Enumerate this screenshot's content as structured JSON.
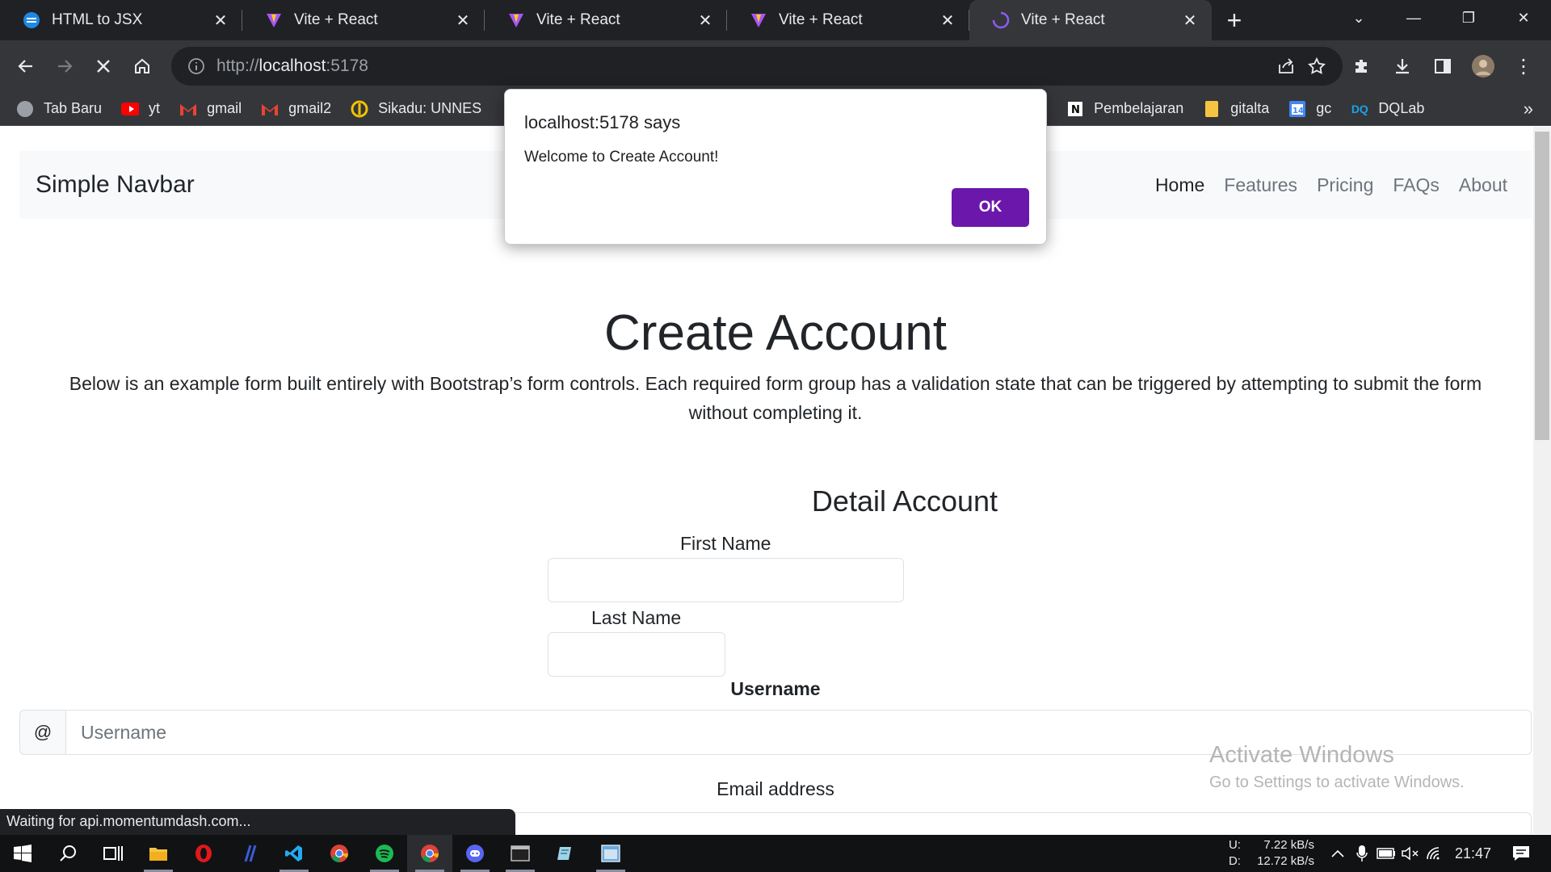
{
  "browser": {
    "tabs": [
      {
        "title": "HTML to JSX",
        "icon": "transform-icon",
        "active": false
      },
      {
        "title": "Vite + React",
        "icon": "vite-icon",
        "active": false
      },
      {
        "title": "Vite + React",
        "icon": "vite-icon",
        "active": false
      },
      {
        "title": "Vite + React",
        "icon": "vite-icon",
        "active": false
      },
      {
        "title": "Vite + React",
        "icon": "loading-spinner-icon",
        "active": true
      }
    ],
    "url_scheme": "http://",
    "url_host": "localhost",
    "url_port": ":5178",
    "bookmarks_left": [
      {
        "label": "Tab Baru",
        "icon": "globe-icon",
        "color": "#9aa0a6"
      },
      {
        "label": "yt",
        "icon": "youtube-icon",
        "color": "#ff0000"
      },
      {
        "label": "gmail",
        "icon": "gmail-icon",
        "color": "#ea4335"
      },
      {
        "label": "gmail2",
        "icon": "gmail-icon",
        "color": "#ea4335"
      },
      {
        "label": "Sikadu: UNNES",
        "icon": "unnes-icon",
        "color": "#f2c200"
      }
    ],
    "bookmarks_right": [
      {
        "label": "Pembelajaran",
        "icon": "notion-icon",
        "color": "#ffffff"
      },
      {
        "label": "gitalta",
        "icon": "folder-icon",
        "color": "#f5c542"
      },
      {
        "label": "gc",
        "icon": "calendar-icon",
        "color": "#4285f4"
      },
      {
        "label": "DQLab",
        "icon": "dqlab-icon",
        "color": "#1aa3e8"
      }
    ],
    "status": "Waiting for api.momentumdash.com..."
  },
  "page": {
    "brand": "Simple Navbar",
    "nav": [
      "Home",
      "Features",
      "Pricing",
      "FAQs",
      "About"
    ],
    "title": "Create Account",
    "lead_line1": "Below is an example form built entirely with Bootstrap’s form controls. Each required form group has a validation state that can be triggered by attempting to submit the form",
    "lead_line2": "without completing it.",
    "section_title": "Detail Account",
    "first_name_label": "First Name",
    "last_name_label": "Last Name",
    "username_label": "Username",
    "username_prefix": "@",
    "username_placeholder": "Username",
    "email_label": "Email address",
    "watermark_title": "Activate Windows",
    "watermark_sub": "Go to Settings to activate Windows."
  },
  "dialog": {
    "title": "localhost:5178 says",
    "message": "Welcome to Create Account!",
    "ok": "OK",
    "accent": "#6b17ab"
  },
  "taskbar": {
    "apps": [
      "windows-start-icon",
      "search-icon",
      "task-view-icon",
      "file-explorer-icon",
      "opera-icon",
      "slash-app-icon",
      "vscode-icon",
      "chrome-icon",
      "spotify-icon",
      "chrome-icon",
      "discord-icon",
      "terminal-icon",
      "notes-icon",
      "window-app-icon"
    ],
    "upload_label": "U:",
    "download_label": "D:",
    "upload_speed": "7.22 kB/s",
    "download_speed": "12.72 kB/s",
    "time": "21:47"
  }
}
